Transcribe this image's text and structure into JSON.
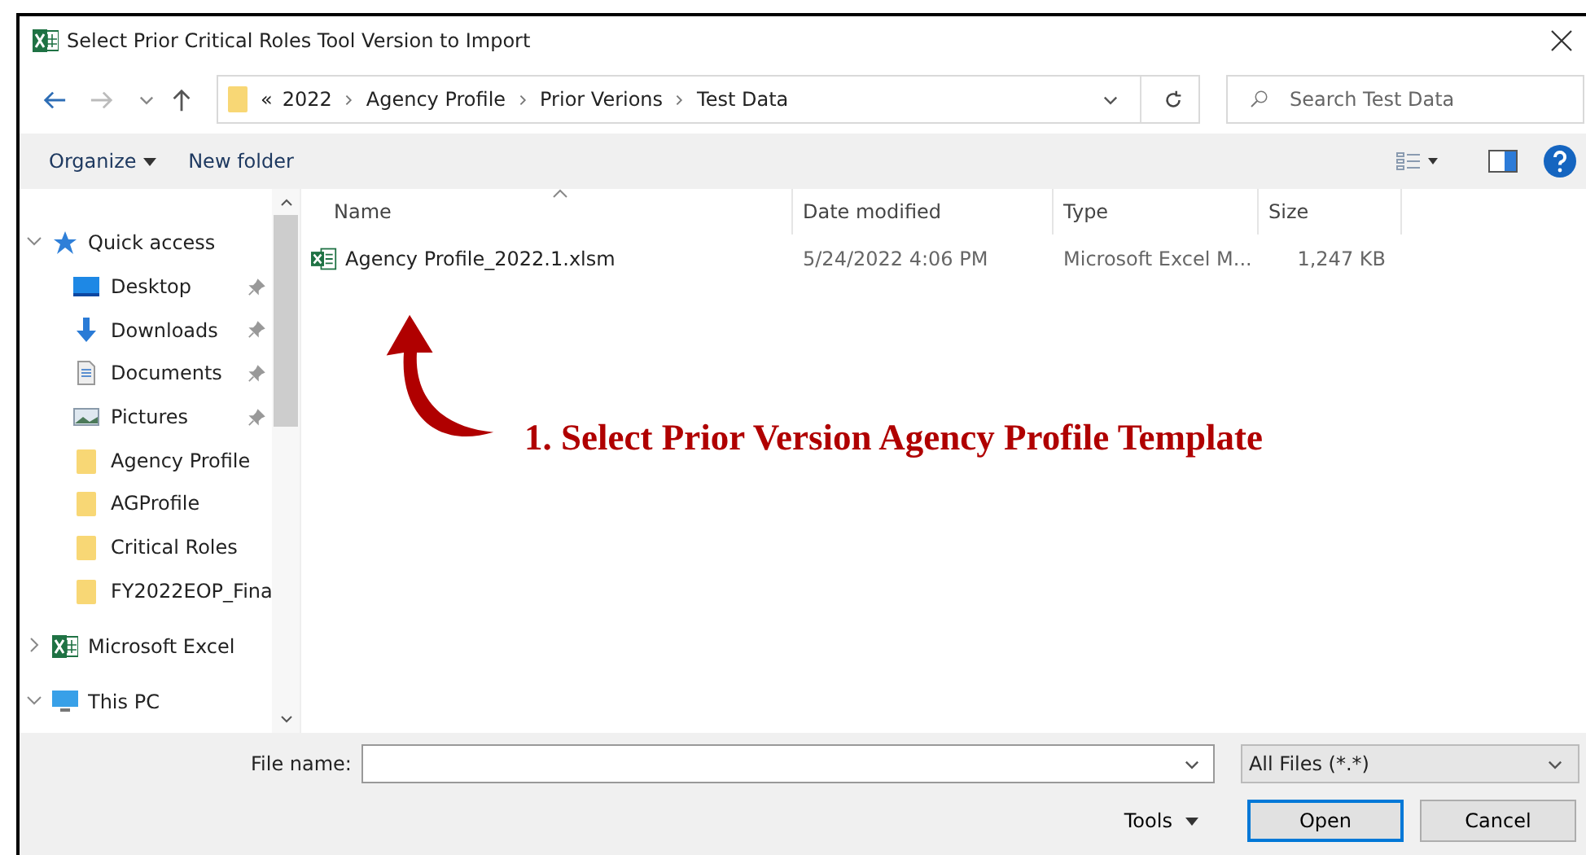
{
  "window": {
    "title": "Select Prior Critical Roles Tool Version to Import"
  },
  "address_bar": {
    "overflow": "«",
    "crumbs": [
      "2022",
      "Agency Profile",
      "Prior Verions",
      "Test Data"
    ]
  },
  "search": {
    "placeholder": "Search Test Data"
  },
  "toolbar": {
    "organize": "Organize",
    "new_folder": "New folder"
  },
  "sidebar": {
    "items": [
      {
        "kind": "star",
        "label": "Quick access",
        "expanded": true,
        "children": [
          {
            "kind": "desktop",
            "label": "Desktop",
            "pinned": true
          },
          {
            "kind": "download",
            "label": "Downloads",
            "pinned": true
          },
          {
            "kind": "document",
            "label": "Documents",
            "pinned": true
          },
          {
            "kind": "pictures",
            "label": "Pictures",
            "pinned": true
          },
          {
            "kind": "folder",
            "label": "Agency Profile",
            "pinned": false
          },
          {
            "kind": "folder",
            "label": "AGProfile",
            "pinned": false
          },
          {
            "kind": "folder",
            "label": "Critical Roles",
            "pinned": false
          },
          {
            "kind": "folder",
            "label": "FY2022EOP_Fina",
            "pinned": false
          }
        ]
      },
      {
        "kind": "excel",
        "label": "Microsoft Excel",
        "expanded": false
      },
      {
        "kind": "pc",
        "label": "This PC",
        "expanded": true
      }
    ]
  },
  "table": {
    "columns": [
      "Name",
      "Date modified",
      "Type",
      "Size"
    ],
    "rows": [
      {
        "name": "Agency Profile_2022.1.xlsm",
        "date": "5/24/2022 4:06 PM",
        "type": "Microsoft Excel M...",
        "size": "1,247 KB"
      }
    ]
  },
  "annotation": {
    "text": "1.  Select Prior Version Agency Profile Template"
  },
  "footer": {
    "file_name_label": "File name:",
    "file_type": "All Files (*.*)",
    "tools": "Tools",
    "open": "Open",
    "cancel": "Cancel"
  }
}
